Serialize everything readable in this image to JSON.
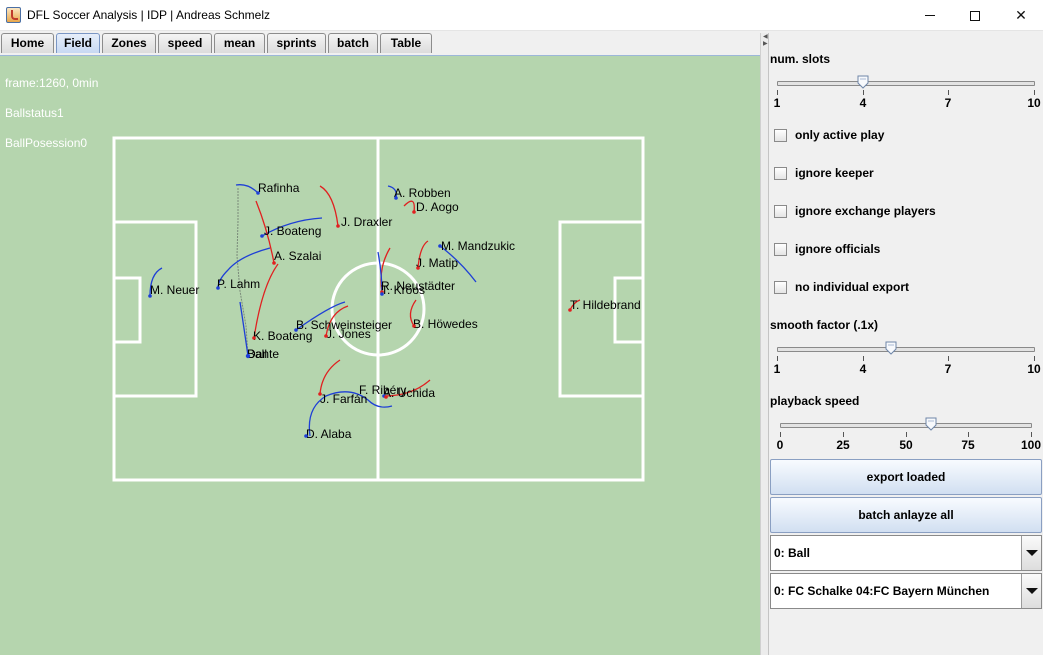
{
  "window": {
    "title": "DFL Soccer Analysis | IDP | Andreas Schmelz",
    "minimize_glyph": "—",
    "maximize_glyph": "☐",
    "close_glyph": "✕"
  },
  "tabs": [
    {
      "label": "Home",
      "active": false
    },
    {
      "label": "Field",
      "active": true
    },
    {
      "label": "Zones",
      "active": false
    },
    {
      "label": "speed",
      "active": false
    },
    {
      "label": "mean",
      "active": false
    },
    {
      "label": "sprints",
      "active": false
    },
    {
      "label": "batch",
      "active": false
    },
    {
      "label": "Table",
      "active": false
    }
  ],
  "field": {
    "info": [
      "frame:1260, 0min",
      "Ballstatus1",
      "BallPosession0"
    ],
    "colors": {
      "background": "#b5d5ae",
      "lines": "#ffffff",
      "team_red": "#e02020",
      "team_blue": "#1e3fd6",
      "ball_trail": "#7a8a7a"
    },
    "players": [
      {
        "name": "Rafinha",
        "team": "blue"
      },
      {
        "name": "J. Draxler",
        "team": "red"
      },
      {
        "name": "A. Robben",
        "team": "blue"
      },
      {
        "name": "D. Aogo",
        "team": "red"
      },
      {
        "name": "J. Boateng",
        "team": "blue"
      },
      {
        "name": "M. Mandzukic",
        "team": "blue"
      },
      {
        "name": "A. Szalai",
        "team": "red"
      },
      {
        "name": "J. Matip",
        "team": "red"
      },
      {
        "name": "P. Lahm",
        "team": "blue"
      },
      {
        "name": "M. Neuer",
        "team": "blue"
      },
      {
        "name": "R. Neustädter",
        "team": "red"
      },
      {
        "name": "T. Kroos",
        "team": "blue"
      },
      {
        "name": "T. Hildebrand",
        "team": "red"
      },
      {
        "name": "B. Schweinsteiger",
        "team": "blue"
      },
      {
        "name": "B. Höwedes",
        "team": "red"
      },
      {
        "name": "J. Jones",
        "team": "red"
      },
      {
        "name": "K. Boateng",
        "team": "red"
      },
      {
        "name": "Ball",
        "team": "ball"
      },
      {
        "name": "Dante",
        "team": "blue"
      },
      {
        "name": "F. Ribéry",
        "team": "blue"
      },
      {
        "name": "A. Uchida",
        "team": "red"
      },
      {
        "name": "J. Farfán",
        "team": "red"
      },
      {
        "name": "D. Alaba",
        "team": "blue"
      }
    ]
  },
  "side": {
    "num_slots": {
      "label": "num. slots",
      "ticks": [
        "1",
        "4",
        "7",
        "10"
      ],
      "min": 1,
      "max": 10,
      "value": 4
    },
    "checkboxes": [
      {
        "label": "only active play",
        "checked": false
      },
      {
        "label": "ignore keeper",
        "checked": false
      },
      {
        "label": "ignore exchange players",
        "checked": false
      },
      {
        "label": "ignore officials",
        "checked": false
      },
      {
        "label": "no individual export",
        "checked": false
      }
    ],
    "smooth_factor": {
      "label": "smooth factor (.1x)",
      "ticks": [
        "1",
        "4",
        "7",
        "10"
      ],
      "min": 1,
      "max": 10,
      "value": 5
    },
    "playback_speed": {
      "label": "playback speed",
      "ticks": [
        "0",
        "25",
        "50",
        "75",
        "100"
      ],
      "min": 0,
      "max": 100,
      "value": 60
    },
    "export_button": "export loaded",
    "batch_button": "batch anlayze all",
    "object_select": "0: Ball",
    "match_select": "0: FC Schalke 04:FC Bayern München"
  }
}
